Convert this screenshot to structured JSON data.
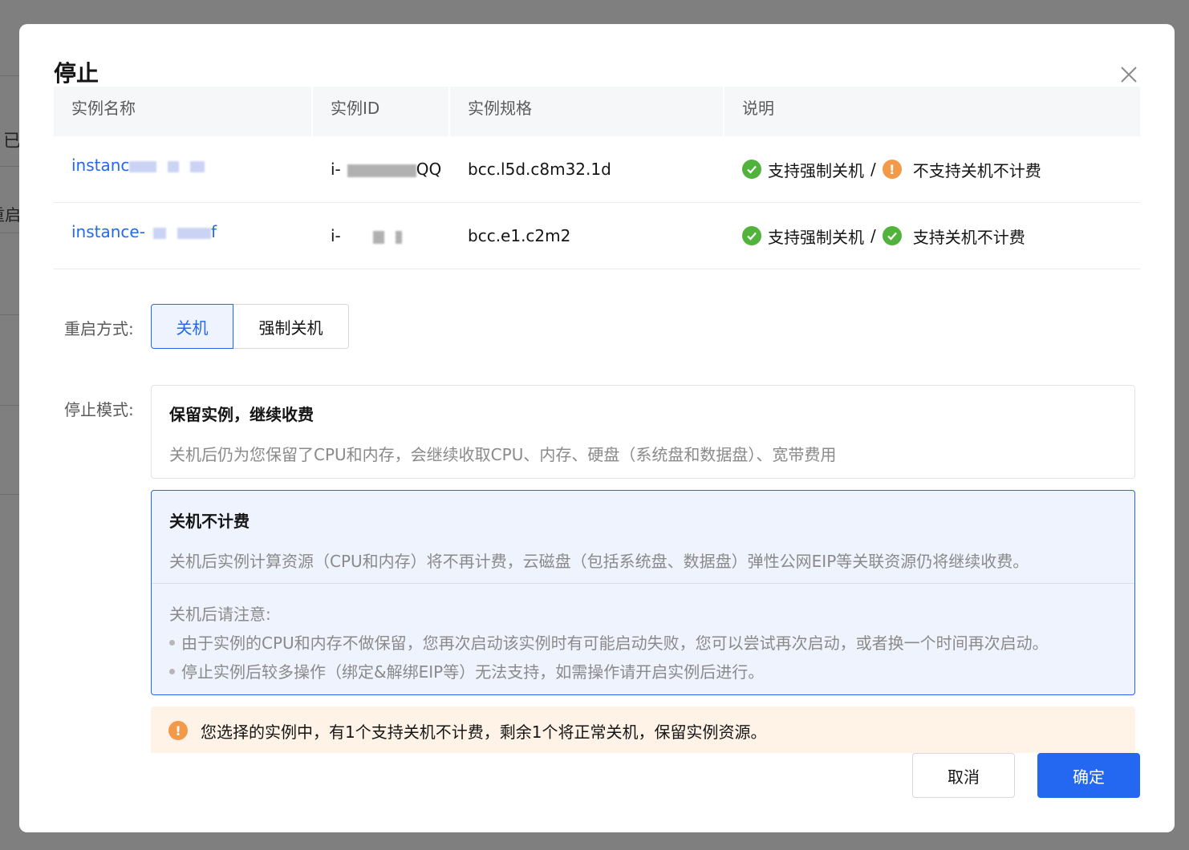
{
  "background": {
    "fragment_1": "已",
    "fragment_2": "重启"
  },
  "modal": {
    "title": "停止",
    "close_icon": "close-icon"
  },
  "table": {
    "headers": [
      "实例名称",
      "实例ID",
      "实例规格",
      "说明"
    ],
    "rows": [
      {
        "name_prefix": "instanc",
        "id_prefix": "i-",
        "id_suffix": "QQ",
        "spec": "bcc.l5d.c8m32.1d",
        "force_shutdown": "支持强制关机",
        "separator": "/",
        "nocharge": "不支持关机不计费",
        "nocharge_status": "warning"
      },
      {
        "name_prefix": "instance-",
        "name_suffix": "f",
        "id_prefix": "i-",
        "spec": "bcc.e1.c2m2",
        "force_shutdown": "支持强制关机",
        "separator": "/",
        "nocharge": "支持关机不计费",
        "nocharge_status": "ok"
      }
    ]
  },
  "restart_mode": {
    "label": "重启方式:",
    "options": [
      "关机",
      "强制关机"
    ],
    "selected": "关机"
  },
  "stop_mode": {
    "label": "停止模式:",
    "keep": {
      "title": "保留实例，继续收费",
      "desc": "关机后仍为您保留了CPU和内存，会继续收取CPU、内存、硬盘（系统盘和数据盘）、宽带费用"
    },
    "nocharge": {
      "title": "关机不计费",
      "desc": "关机后实例计算资源（CPU和内存）将不再计费，云磁盘（包括系统盘、数据盘）弹性公网EIP等关联资源仍将继续收费。",
      "note_title": "关机后请注意:",
      "notes": [
        "由于实例的CPU和内存不做保留，您再次启动该实例时有可能启动失败，您可以尝试再次启动，或者换一个时间再次启动。",
        "停止实例后较多操作（绑定&解绑EIP等）无法支持，如需操作请开启实例后进行。"
      ]
    },
    "selected": "nocharge"
  },
  "alert": {
    "text": "您选择的实例中，有1个支持关机不计费，剩余1个将正常关机，保留实例资源。"
  },
  "footer": {
    "cancel": "取消",
    "confirm": "确定"
  },
  "colors": {
    "primary": "#2468f2",
    "success": "#52b33c",
    "warning": "#f2994a",
    "alert_bg": "#fef3e6"
  }
}
